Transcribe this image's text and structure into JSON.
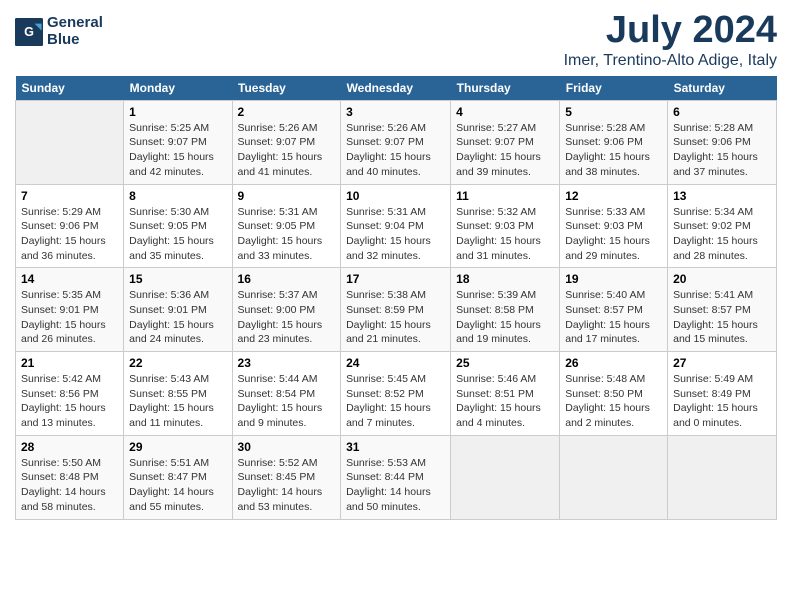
{
  "header": {
    "logo_line1": "General",
    "logo_line2": "Blue",
    "month": "July 2024",
    "location": "Imer, Trentino-Alto Adige, Italy"
  },
  "days_of_week": [
    "Sunday",
    "Monday",
    "Tuesday",
    "Wednesday",
    "Thursday",
    "Friday",
    "Saturday"
  ],
  "weeks": [
    [
      {
        "day": "",
        "info": ""
      },
      {
        "day": "1",
        "info": "Sunrise: 5:25 AM\nSunset: 9:07 PM\nDaylight: 15 hours\nand 42 minutes."
      },
      {
        "day": "2",
        "info": "Sunrise: 5:26 AM\nSunset: 9:07 PM\nDaylight: 15 hours\nand 41 minutes."
      },
      {
        "day": "3",
        "info": "Sunrise: 5:26 AM\nSunset: 9:07 PM\nDaylight: 15 hours\nand 40 minutes."
      },
      {
        "day": "4",
        "info": "Sunrise: 5:27 AM\nSunset: 9:07 PM\nDaylight: 15 hours\nand 39 minutes."
      },
      {
        "day": "5",
        "info": "Sunrise: 5:28 AM\nSunset: 9:06 PM\nDaylight: 15 hours\nand 38 minutes."
      },
      {
        "day": "6",
        "info": "Sunrise: 5:28 AM\nSunset: 9:06 PM\nDaylight: 15 hours\nand 37 minutes."
      }
    ],
    [
      {
        "day": "7",
        "info": "Sunrise: 5:29 AM\nSunset: 9:06 PM\nDaylight: 15 hours\nand 36 minutes."
      },
      {
        "day": "8",
        "info": "Sunrise: 5:30 AM\nSunset: 9:05 PM\nDaylight: 15 hours\nand 35 minutes."
      },
      {
        "day": "9",
        "info": "Sunrise: 5:31 AM\nSunset: 9:05 PM\nDaylight: 15 hours\nand 33 minutes."
      },
      {
        "day": "10",
        "info": "Sunrise: 5:31 AM\nSunset: 9:04 PM\nDaylight: 15 hours\nand 32 minutes."
      },
      {
        "day": "11",
        "info": "Sunrise: 5:32 AM\nSunset: 9:03 PM\nDaylight: 15 hours\nand 31 minutes."
      },
      {
        "day": "12",
        "info": "Sunrise: 5:33 AM\nSunset: 9:03 PM\nDaylight: 15 hours\nand 29 minutes."
      },
      {
        "day": "13",
        "info": "Sunrise: 5:34 AM\nSunset: 9:02 PM\nDaylight: 15 hours\nand 28 minutes."
      }
    ],
    [
      {
        "day": "14",
        "info": "Sunrise: 5:35 AM\nSunset: 9:01 PM\nDaylight: 15 hours\nand 26 minutes."
      },
      {
        "day": "15",
        "info": "Sunrise: 5:36 AM\nSunset: 9:01 PM\nDaylight: 15 hours\nand 24 minutes."
      },
      {
        "day": "16",
        "info": "Sunrise: 5:37 AM\nSunset: 9:00 PM\nDaylight: 15 hours\nand 23 minutes."
      },
      {
        "day": "17",
        "info": "Sunrise: 5:38 AM\nSunset: 8:59 PM\nDaylight: 15 hours\nand 21 minutes."
      },
      {
        "day": "18",
        "info": "Sunrise: 5:39 AM\nSunset: 8:58 PM\nDaylight: 15 hours\nand 19 minutes."
      },
      {
        "day": "19",
        "info": "Sunrise: 5:40 AM\nSunset: 8:57 PM\nDaylight: 15 hours\nand 17 minutes."
      },
      {
        "day": "20",
        "info": "Sunrise: 5:41 AM\nSunset: 8:57 PM\nDaylight: 15 hours\nand 15 minutes."
      }
    ],
    [
      {
        "day": "21",
        "info": "Sunrise: 5:42 AM\nSunset: 8:56 PM\nDaylight: 15 hours\nand 13 minutes."
      },
      {
        "day": "22",
        "info": "Sunrise: 5:43 AM\nSunset: 8:55 PM\nDaylight: 15 hours\nand 11 minutes."
      },
      {
        "day": "23",
        "info": "Sunrise: 5:44 AM\nSunset: 8:54 PM\nDaylight: 15 hours\nand 9 minutes."
      },
      {
        "day": "24",
        "info": "Sunrise: 5:45 AM\nSunset: 8:52 PM\nDaylight: 15 hours\nand 7 minutes."
      },
      {
        "day": "25",
        "info": "Sunrise: 5:46 AM\nSunset: 8:51 PM\nDaylight: 15 hours\nand 4 minutes."
      },
      {
        "day": "26",
        "info": "Sunrise: 5:48 AM\nSunset: 8:50 PM\nDaylight: 15 hours\nand 2 minutes."
      },
      {
        "day": "27",
        "info": "Sunrise: 5:49 AM\nSunset: 8:49 PM\nDaylight: 15 hours\nand 0 minutes."
      }
    ],
    [
      {
        "day": "28",
        "info": "Sunrise: 5:50 AM\nSunset: 8:48 PM\nDaylight: 14 hours\nand 58 minutes."
      },
      {
        "day": "29",
        "info": "Sunrise: 5:51 AM\nSunset: 8:47 PM\nDaylight: 14 hours\nand 55 minutes."
      },
      {
        "day": "30",
        "info": "Sunrise: 5:52 AM\nSunset: 8:45 PM\nDaylight: 14 hours\nand 53 minutes."
      },
      {
        "day": "31",
        "info": "Sunrise: 5:53 AM\nSunset: 8:44 PM\nDaylight: 14 hours\nand 50 minutes."
      },
      {
        "day": "",
        "info": ""
      },
      {
        "day": "",
        "info": ""
      },
      {
        "day": "",
        "info": ""
      }
    ]
  ]
}
